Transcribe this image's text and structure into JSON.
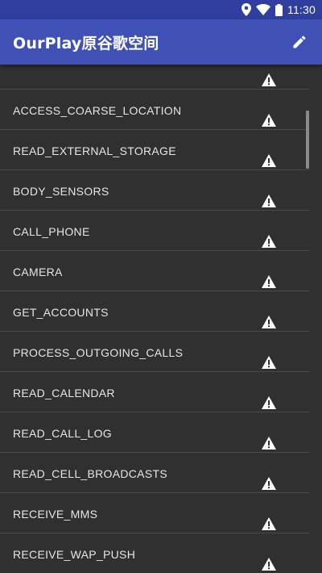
{
  "status_bar": {
    "time": "11:30"
  },
  "app_bar": {
    "title": "OurPlay原谷歌空间"
  },
  "permissions": [
    {
      "label": ""
    },
    {
      "label": "ACCESS_COARSE_LOCATION"
    },
    {
      "label": "READ_EXTERNAL_STORAGE"
    },
    {
      "label": "BODY_SENSORS"
    },
    {
      "label": "CALL_PHONE"
    },
    {
      "label": "CAMERA"
    },
    {
      "label": "GET_ACCOUNTS"
    },
    {
      "label": "PROCESS_OUTGOING_CALLS"
    },
    {
      "label": "READ_CALENDAR"
    },
    {
      "label": "READ_CALL_LOG"
    },
    {
      "label": "READ_CELL_BROADCASTS"
    },
    {
      "label": "RECEIVE_MMS"
    },
    {
      "label": "RECEIVE_WAP_PUSH"
    }
  ],
  "icons": {
    "row_icon": "warning-icon",
    "edit": "pencil-icon"
  },
  "colors": {
    "app_bar": "#3f51b5",
    "status_bar": "#303f9f",
    "background": "#303030"
  }
}
